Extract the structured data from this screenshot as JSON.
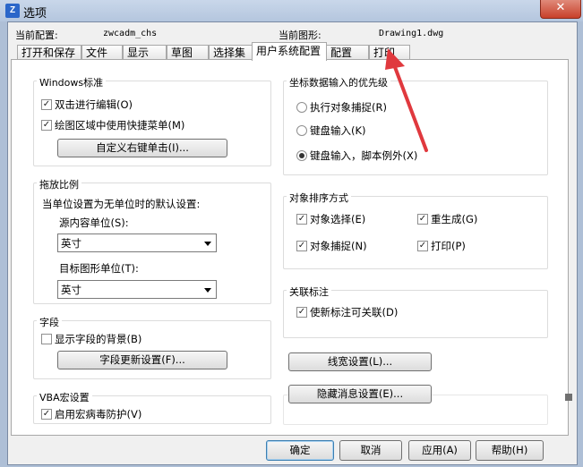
{
  "window": {
    "title": "选项",
    "icon": "app-logo-icon",
    "close_label": "✕"
  },
  "header": {
    "current_profile_label": "当前配置:",
    "current_profile_value": "zwcadm_chs",
    "current_drawing_label": "当前图形:",
    "current_drawing_value": "Drawing1.dwg"
  },
  "tabs": [
    {
      "label": "打开和保存"
    },
    {
      "label": "文件"
    },
    {
      "label": "显示"
    },
    {
      "label": "草图"
    },
    {
      "label": "选择集"
    },
    {
      "label": "用户系统配置",
      "active": true
    },
    {
      "label": "配置"
    },
    {
      "label": "打印"
    }
  ],
  "windows_std": {
    "title": "Windows标准",
    "dblclick_edit": {
      "label": "双击进行编辑(O)",
      "checked": true
    },
    "shortcut_menu": {
      "label": "绘图区域中使用快捷菜单(M)",
      "checked": true
    },
    "custom_right_click": "自定义右键单击(I)..."
  },
  "drag_scale": {
    "title": "拖放比例",
    "desc": "当单位设置为无单位时的默认设置:",
    "source_label": "源内容单位(S):",
    "source_value": "英寸",
    "target_label": "目标图形单位(T):",
    "target_value": "英寸"
  },
  "field": {
    "title": "字段",
    "show_bg": {
      "label": "显示字段的背景(B)",
      "checked": false
    },
    "update_settings": "字段更新设置(F)..."
  },
  "vba": {
    "title": "VBA宏设置",
    "virus_protect": {
      "label": "启用宏病毒防护(V)",
      "checked": true
    }
  },
  "coord_priority": {
    "title": "坐标数据输入的优先级",
    "options": [
      {
        "label": "执行对象捕捉(R)",
        "selected": false
      },
      {
        "label": "键盘输入(K)",
        "selected": false
      },
      {
        "label": "键盘输入，脚本例外(X)",
        "selected": true
      }
    ]
  },
  "sort_method": {
    "title": "对象排序方式",
    "obj_select": {
      "label": "对象选择(E)",
      "checked": true
    },
    "regen": {
      "label": "重生成(G)",
      "checked": true
    },
    "obj_snap": {
      "label": "对象捕捉(N)",
      "checked": true
    },
    "plot": {
      "label": "打印(P)",
      "checked": true
    }
  },
  "assoc_dim": {
    "title": "关联标注",
    "new_assoc": {
      "label": "使新标注可关联(D)",
      "checked": true
    }
  },
  "lineweight_btn": "线宽设置(L)...",
  "hidden_msg_btn": "隐藏消息设置(E)...",
  "footer": {
    "ok": "确定",
    "cancel": "取消",
    "apply": "应用(A)",
    "help": "帮助(H)"
  },
  "annotation": {
    "color": "#e0393e"
  }
}
